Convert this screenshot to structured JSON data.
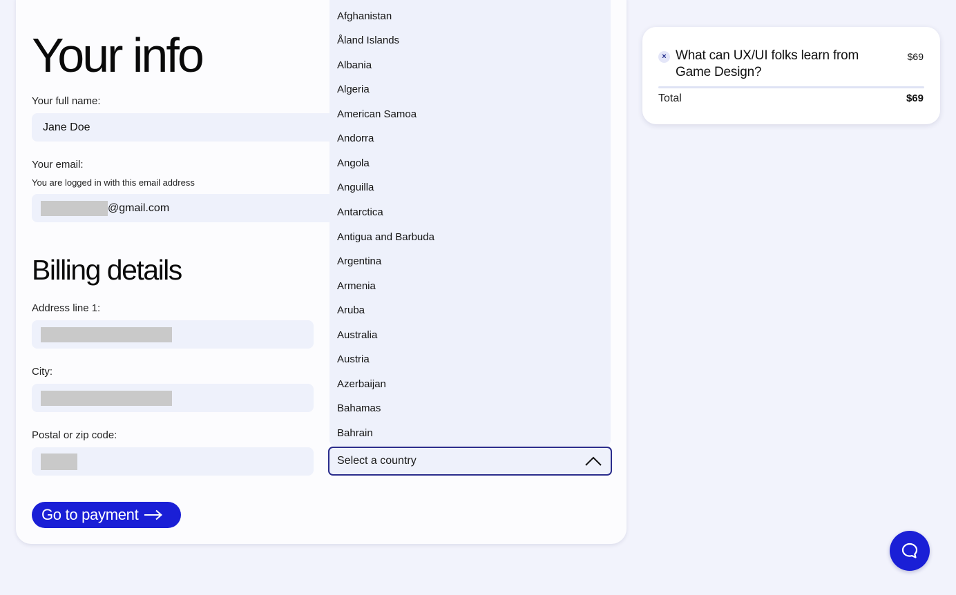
{
  "form": {
    "title": "Your info",
    "full_name_label": "Your full name:",
    "full_name_value": "Jane Doe",
    "email_label": "Your email:",
    "email_note": "You are logged in with this email address",
    "email_domain": "@gmail.com",
    "billing_title": "Billing details",
    "address_label": "Address line 1:",
    "city_label": "City:",
    "postal_label": "Postal or zip code:",
    "submit_label": "Go to payment"
  },
  "country_select": {
    "placeholder": "Select a country",
    "options": [
      "Afghanistan",
      "Åland Islands",
      "Albania",
      "Algeria",
      "American Samoa",
      "Andorra",
      "Angola",
      "Anguilla",
      "Antarctica",
      "Antigua and Barbuda",
      "Argentina",
      "Armenia",
      "Aruba",
      "Australia",
      "Austria",
      "Azerbaijan",
      "Bahamas",
      "Bahrain"
    ]
  },
  "summary": {
    "item_title": "What can UX/UI folks learn from Game Design?",
    "item_price": "$69",
    "total_label": "Total",
    "total_value": "$69",
    "remove_icon": "close-icon"
  },
  "colors": {
    "accent": "#1a1fd6",
    "field_bg": "#eef1fb",
    "page_bg": "#f2f3fc",
    "select_border": "#2a2c8c"
  }
}
